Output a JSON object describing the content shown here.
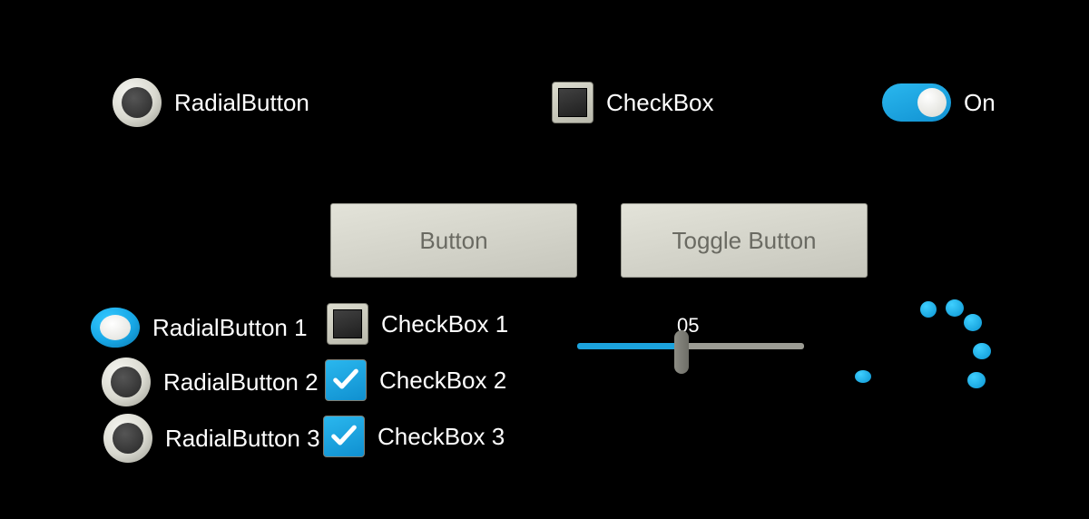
{
  "top": {
    "radial_label": "RadialButton",
    "checkbox_label": "CheckBox",
    "toggle_label": "On"
  },
  "buttons": {
    "button_label": "Button",
    "toggle_button_label": "Toggle Button"
  },
  "radials": [
    {
      "label": "RadialButton 1",
      "checked": true
    },
    {
      "label": "RadialButton 2",
      "checked": false
    },
    {
      "label": "RadialButton 3",
      "checked": false
    }
  ],
  "checkboxes": [
    {
      "label": "CheckBox 1",
      "checked": false
    },
    {
      "label": "CheckBox 2",
      "checked": true
    },
    {
      "label": "CheckBox 3",
      "checked": true
    }
  ],
  "slider": {
    "value": "05",
    "percent": 46
  },
  "accent": "#19a8e0"
}
